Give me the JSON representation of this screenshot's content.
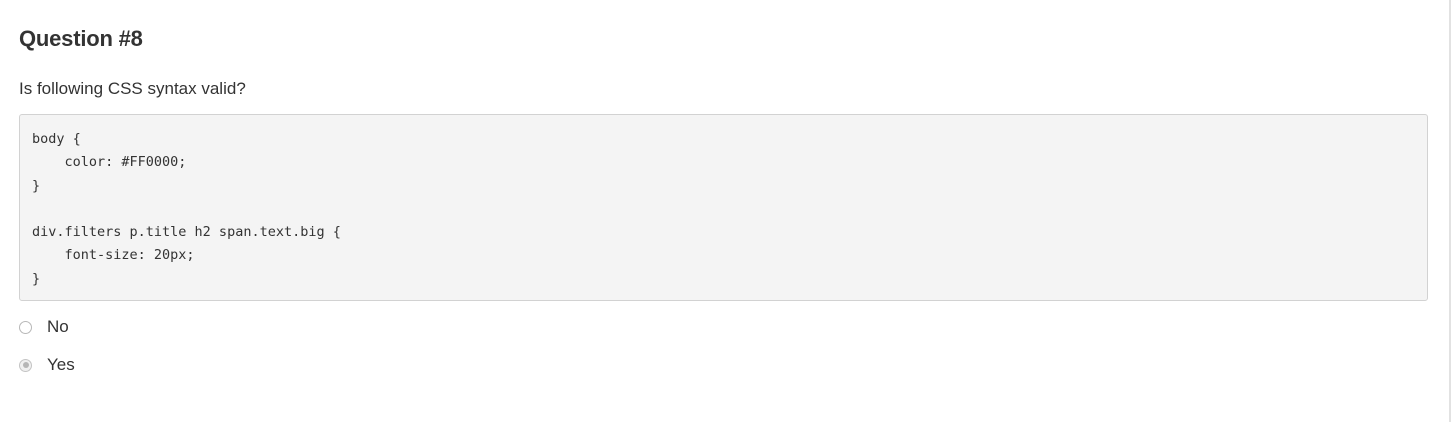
{
  "question": {
    "title": "Question #8",
    "text": "Is following CSS syntax valid?",
    "code": "body {\n    color: #FF0000;\n}\n\ndiv.filters p.title h2 span.text.big {\n    font-size: 20px;\n}"
  },
  "options": [
    {
      "label": "No",
      "selected": false
    },
    {
      "label": "Yes",
      "selected": true
    }
  ],
  "colors": {
    "text": "#333333",
    "code_background": "#f4f4f4",
    "code_border": "#d2d2d2"
  }
}
